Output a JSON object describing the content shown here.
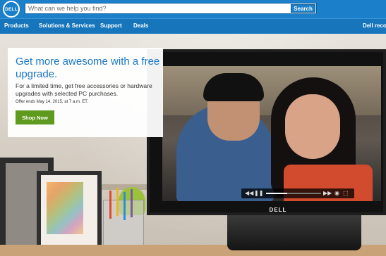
{
  "header": {
    "logo_text": "DELL",
    "search": {
      "placeholder": "What can we help you find?",
      "value": "",
      "button_label": "Search"
    }
  },
  "nav": {
    "items": [
      "Products",
      "Solutions & Services",
      "Support",
      "Deals"
    ],
    "right_item": "Dell recon"
  },
  "hero": {
    "title": "Get more awesome with a free upgrade.",
    "body": "For a limited time, get free accessories or hardware upgrades with selected PC purchases.",
    "offer_text": "Offer ends May 14, 2015, at 7 a.m. ET.",
    "cta_label": "Shop Now",
    "monitor_brand": "DELL"
  },
  "video_player": {
    "progress": 0.38
  },
  "colors": {
    "header_blue": "#1b7fc9",
    "nav_blue": "#1776bb",
    "title_blue": "#1a77c5",
    "cta_green": "#5e9a1d"
  }
}
